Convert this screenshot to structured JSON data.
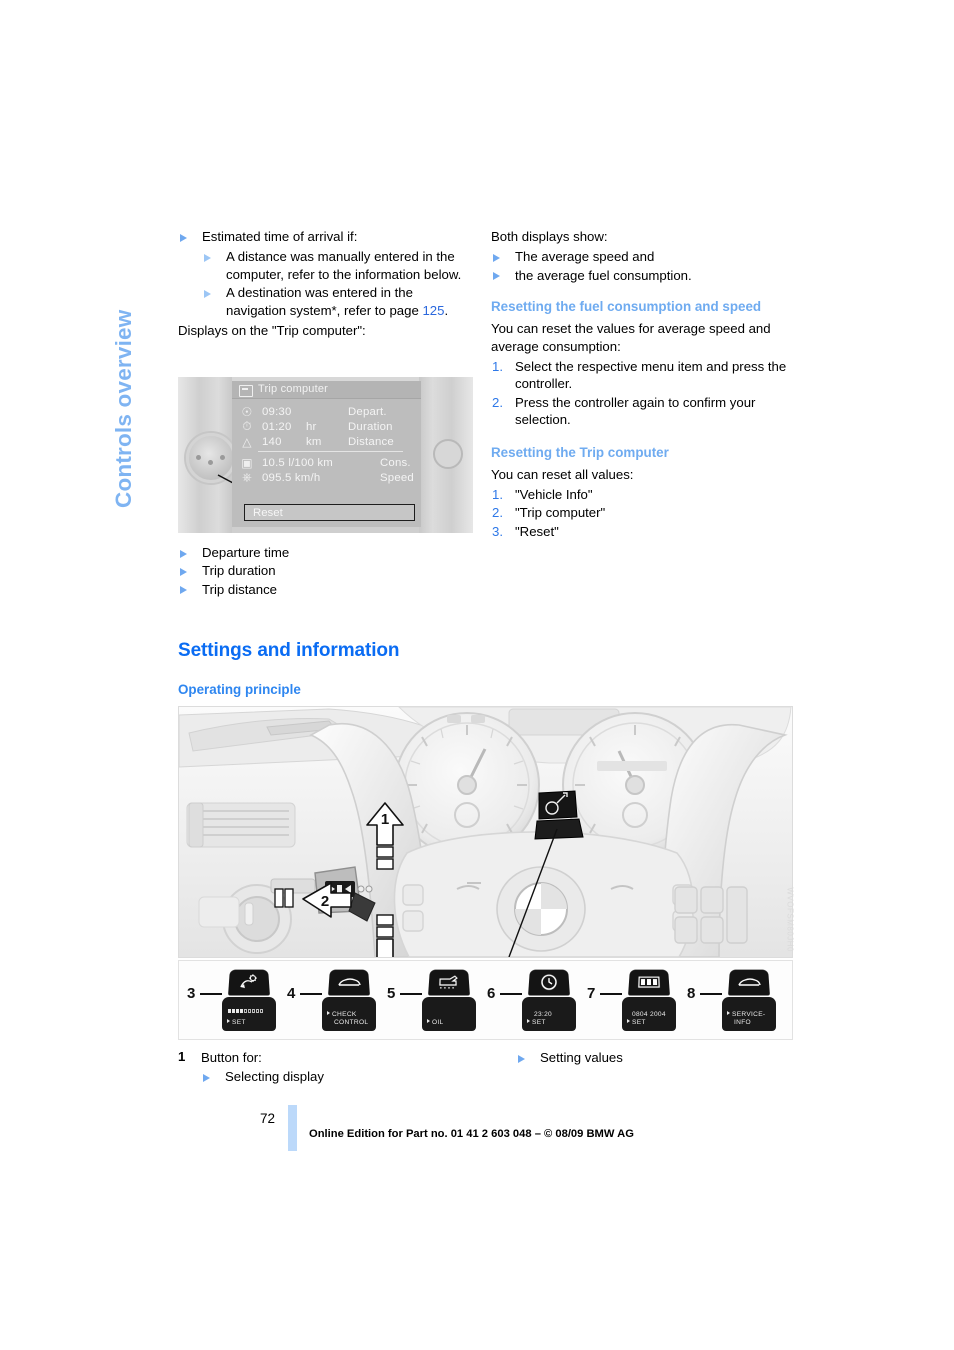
{
  "chapter_tab": "Controls overview",
  "left_column": {
    "bullets": [
      {
        "text": "Estimated time of arrival if:",
        "sub": [
          "A distance was manually entered in the computer, refer to the information below.",
          "A destination was entered in the navigation system*, refer to page "
        ],
        "sub_link": "125",
        "sub_link_suffix": "."
      }
    ],
    "intro": "Displays on the \"Trip computer\":",
    "figure_legend": [
      "Departure time",
      "Trip duration",
      "Trip distance"
    ]
  },
  "trip_computer": {
    "title": "Trip computer",
    "rows": [
      {
        "icon": "steering-wheel-clock-icon",
        "value": "09:30",
        "unit": "",
        "label": "Depart."
      },
      {
        "icon": "stopwatch-icon",
        "value": "01:20",
        "unit": "hr",
        "label": "Duration"
      },
      {
        "icon": "distance-icon",
        "value": "140",
        "unit": "km",
        "label": "Distance"
      },
      {
        "icon": "fuel-pump-icon",
        "value": "10.5 l/100 km",
        "unit": "",
        "label": "Cons."
      },
      {
        "icon": "speed-gauge-icon",
        "value": "095.5 km/h",
        "unit": "",
        "label": "Speed"
      }
    ],
    "reset_button": "Reset"
  },
  "right_column": {
    "both_displays_intro": "Both displays show:",
    "both_displays_bullets": [
      "The average speed and",
      "the average fuel consumption."
    ],
    "heading_reset_fuel": "Resetting the fuel consumption and speed",
    "reset_fuel_intro": "You can reset the values for average speed and average consumption:",
    "reset_fuel_steps": [
      "Select the respective menu item and press the controller.",
      "Press the controller again to confirm your selection."
    ],
    "heading_reset_trip": "Resetting the Trip computer",
    "reset_trip_intro": "You can reset all values:",
    "reset_trip_steps": [
      "\"Vehicle Info\"",
      "\"Trip computer\"",
      "\"Reset\""
    ]
  },
  "section": {
    "title": "Settings and information",
    "subtitle": "Operating principle"
  },
  "dashboard_figure": {
    "callouts": [
      {
        "number": "1",
        "position": "upper-arrow"
      },
      {
        "number": "2",
        "position": "left-arrow"
      },
      {
        "number": "1",
        "position": "lower-arrow"
      }
    ],
    "figure_code": "WVOFSM80JH0",
    "keys": [
      {
        "number": "3",
        "icon": "brightness-dimmer-icon",
        "display_line1": "",
        "display_line2": "SET",
        "has_bars": true,
        "bars_on": 4,
        "bars_off": 5
      },
      {
        "number": "4",
        "icon": "car-icon",
        "display_line1": "CHECK",
        "display_line2": "CONTROL",
        "has_bars": false
      },
      {
        "number": "5",
        "icon": "oil-can-icon",
        "display_line1": "",
        "display_line2": "OIL",
        "has_bars": false
      },
      {
        "number": "6",
        "icon": "clock-icon",
        "display_line1": "23:20",
        "display_line2": "SET",
        "has_bars": false
      },
      {
        "number": "7",
        "icon": "calendar-icon",
        "display_line1": "0804 2004",
        "display_line2": "SET",
        "has_bars": false
      },
      {
        "number": "8",
        "icon": "car-icon",
        "display_line1": "SERVICE-",
        "display_line2": "INFO",
        "has_bars": false
      }
    ]
  },
  "caption": {
    "number": "1",
    "label": "Button for:",
    "left_bullet": "Selecting display",
    "right_bullet": "Setting values"
  },
  "footer": {
    "page_number": "72",
    "text": "Online Edition for Part no. 01 41 2 603 048 – © 08/09 BMW AG"
  },
  "colors": {
    "section_blue": "#0a6cf3",
    "sub_blue": "#6fabf0",
    "tab_blue": "#7fb4f2",
    "link_blue": "#2b68dd",
    "footer_bar": "#bcd9fa"
  }
}
